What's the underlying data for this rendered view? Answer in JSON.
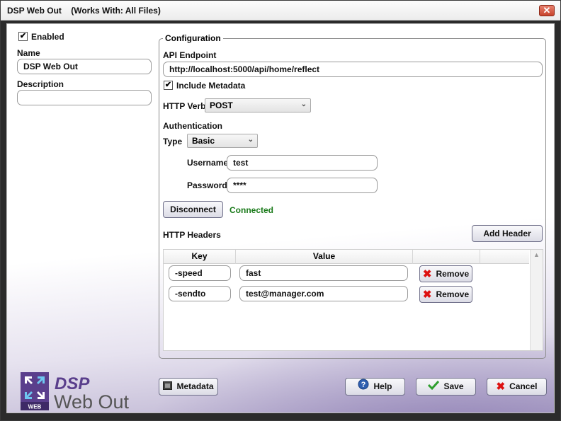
{
  "window": {
    "title": "DSP Web Out",
    "subtitle": "(Works With: All Files)",
    "close_glyph": "✕"
  },
  "left": {
    "enabled_label": "Enabled",
    "enabled_checked": true,
    "name_label": "Name",
    "name_value": "DSP Web Out",
    "description_label": "Description",
    "description_value": ""
  },
  "config": {
    "group_title": "Configuration",
    "api_endpoint_label": "API Endpoint",
    "api_endpoint_value": "http://localhost:5000/api/home/reflect",
    "include_metadata_label": "Include Metadata",
    "include_metadata_checked": true,
    "http_verb_label": "HTTP Verb",
    "http_verb_value": "POST",
    "authentication_label": "Authentication",
    "type_label": "Type",
    "type_value": "Basic",
    "username_label": "Username",
    "username_value": "test",
    "password_label": "Password",
    "password_value": "****",
    "disconnect_label": "Disconnect",
    "status_text": "Connected",
    "status_color": "#1a7a1a",
    "http_headers_label": "HTTP Headers",
    "add_header_label": "Add Header",
    "headers_columns": [
      "Key",
      "Value"
    ],
    "headers": [
      {
        "key": "-speed",
        "value": "fast",
        "remove_label": "Remove"
      },
      {
        "key": "-sendto",
        "value": "test@manager.com",
        "remove_label": "Remove"
      }
    ]
  },
  "logo": {
    "line1": "DSP",
    "line2": "Web Out",
    "badge": "WEB",
    "accent_color": "#5a3f8c"
  },
  "footer": {
    "metadata_label": "Metadata",
    "help_label": "Help",
    "save_label": "Save",
    "cancel_label": "Cancel"
  },
  "icons": {
    "check": "✔",
    "chevron": "⌄",
    "remove": "✖",
    "scroll_up": "▲"
  }
}
